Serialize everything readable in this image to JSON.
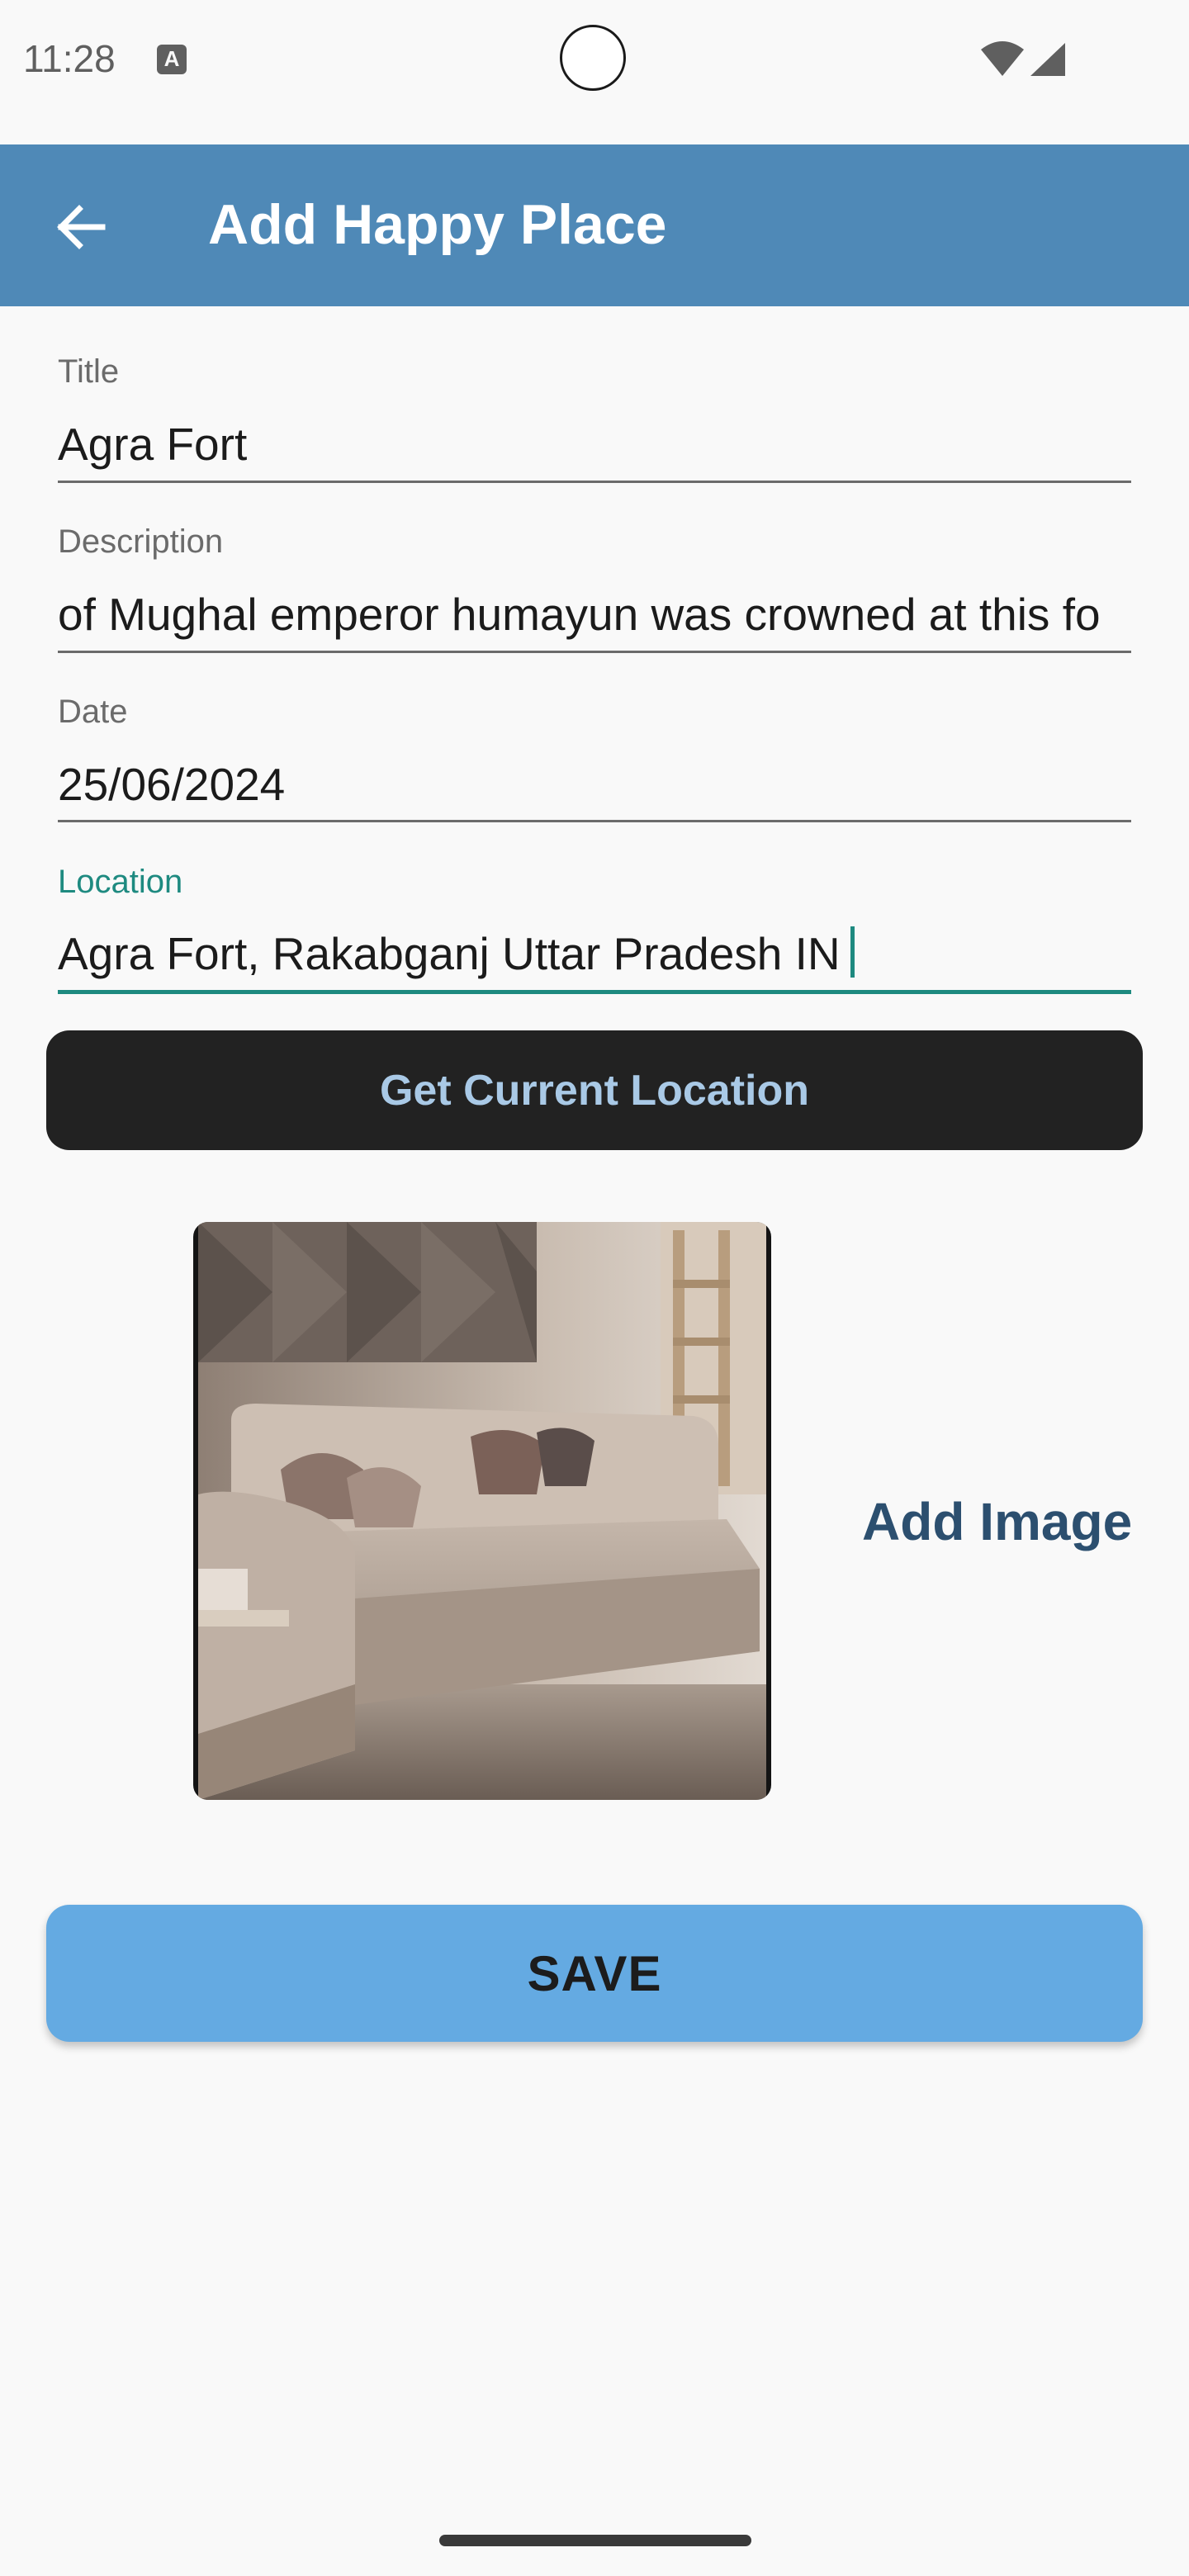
{
  "status_bar": {
    "time": "11:28",
    "notification_glyph": "A"
  },
  "app_bar": {
    "title": "Add Happy Place",
    "back_icon": "arrow-back-icon"
  },
  "form": {
    "title": {
      "label": "Title",
      "value": "Agra Fort"
    },
    "description": {
      "label": "Description",
      "value": " of Mughal emperor humayun was crowned at this fo"
    },
    "date": {
      "label": "Date",
      "value": "25/06/2024"
    },
    "location": {
      "label": "Location",
      "value": "Agra Fort, Rakabganj Uttar Pradesh IN"
    }
  },
  "actions": {
    "current_location_label": "Get Current Location",
    "add_image_label": "Add Image",
    "save_label": "SAVE"
  },
  "colors": {
    "app_bar": "#4f89b7",
    "accent": "#1e8a80",
    "save_button": "#64aae2",
    "location_button": "#222222"
  }
}
